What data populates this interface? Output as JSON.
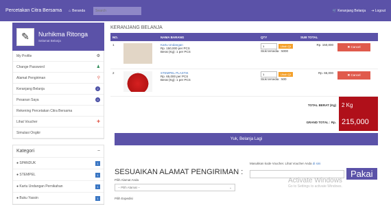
{
  "topbar": {
    "brand": "Percetakan Citra Bersama",
    "home_label": "Beranda",
    "search_placeholder": "Search",
    "cart_label": "Keranjang Belanja",
    "logout_label": "Logout"
  },
  "sidebar": {
    "user_name": "Nurhikma Ritonga",
    "user_sub": "Selamat Belanja",
    "menu": [
      {
        "label": "My Profile"
      },
      {
        "label": "Change Password"
      },
      {
        "label": "Alamat Pengiriman"
      },
      {
        "label": "Keranjang Belanja"
      },
      {
        "label": "Pesanan Saya"
      },
      {
        "label": "Rekening Percetakan Citra Bersama"
      },
      {
        "label": "Lihat Voucher"
      },
      {
        "label": "Simulasi Ongkir"
      }
    ],
    "kategori_title": "Kategori",
    "kategori_toggle": "−",
    "kategori": [
      {
        "label": "SPANDUK"
      },
      {
        "label": "STEMPEL"
      },
      {
        "label": "Kartu Undangan Pernikahan"
      },
      {
        "label": "Buku Yassin"
      }
    ]
  },
  "main": {
    "title": "KERANJANG BELANJA",
    "columns": [
      "NO.",
      "",
      "NAMA BARANG",
      "QTY",
      "SUB TOTAL",
      ""
    ],
    "rows": [
      {
        "no": "1",
        "name": "Kartu Undangan",
        "price": "Rp. 150,000 per PCS",
        "weight": "Berat (Kg): 1 per PCS",
        "qty": "1",
        "update": "Ubah Qt",
        "stock": "Stok tersedia : 5000",
        "subtotal": "Rp. 150,000",
        "cancel": "✖ Cancel"
      },
      {
        "no": "2",
        "name": "STEMPEL PLASTIK",
        "price": "Rp. 65,000 per PCS",
        "weight": "Berat (Kg): 1 per PCS",
        "qty": "1",
        "update": "Ubah Qt",
        "stock": "Stok tersedia : 500",
        "subtotal": "Rp. 65,000",
        "cancel": "✖ Cancel"
      }
    ],
    "total_weight_label": "TOTAL BERAT (Kg)",
    "total_weight": "2 Kg",
    "grand_total_label": "GRAND TOTAL : Rp.",
    "grand_total": "215,000",
    "continue_label": "Yuk, Belanja Lagi",
    "shipping_title": "SESUAIKAN ALAMAT PENGIRIMAN :",
    "address_label": "Pilih Alamat Anda",
    "address_select": "-- Pilih Alamat --",
    "courier_label": "Pilih Expedisi",
    "voucher_label": "Masukkan kode Voucher. Lihat Voucher Anda",
    "voucher_link": "di sini",
    "pakai_label": "Pakai",
    "watermark_title": "Activate Windows",
    "watermark_sub": "Go to Settings to activate Windows."
  }
}
